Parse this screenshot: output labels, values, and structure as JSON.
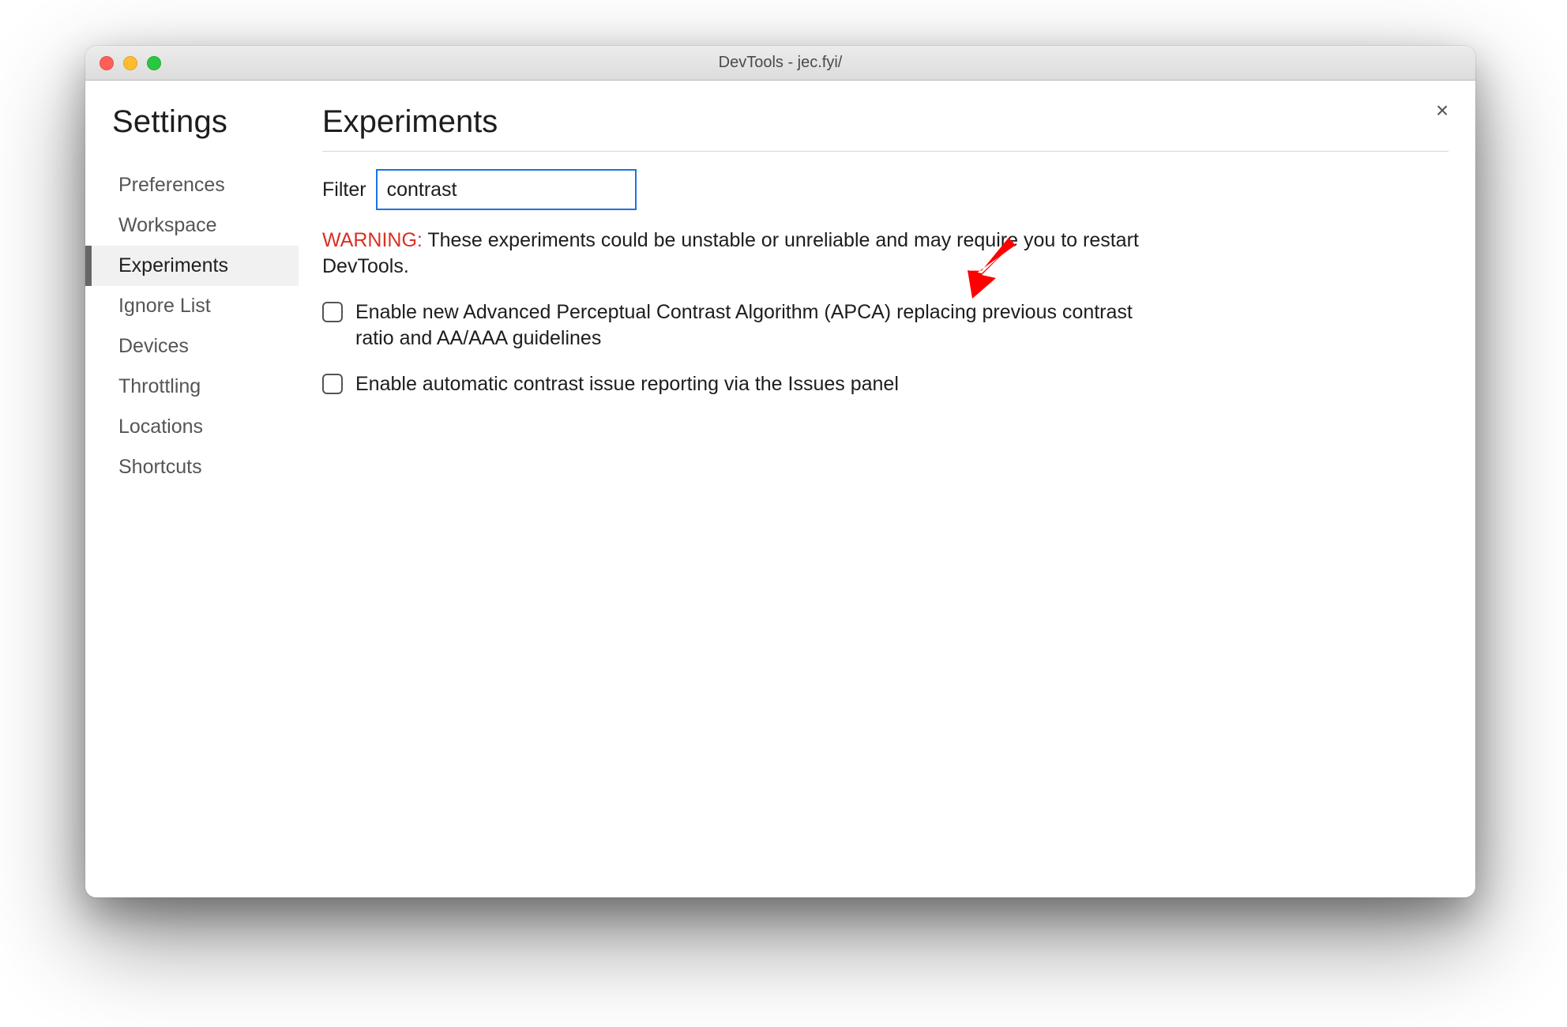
{
  "window": {
    "title": "DevTools - jec.fyi/"
  },
  "sidebar": {
    "title": "Settings",
    "items": [
      {
        "label": "Preferences",
        "active": false
      },
      {
        "label": "Workspace",
        "active": false
      },
      {
        "label": "Experiments",
        "active": true
      },
      {
        "label": "Ignore List",
        "active": false
      },
      {
        "label": "Devices",
        "active": false
      },
      {
        "label": "Throttling",
        "active": false
      },
      {
        "label": "Locations",
        "active": false
      },
      {
        "label": "Shortcuts",
        "active": false
      }
    ]
  },
  "content": {
    "title": "Experiments",
    "filter_label": "Filter",
    "filter_value": "contrast",
    "warning_prefix": "WARNING:",
    "warning_text": " These experiments could be unstable or unreliable and may require you to restart DevTools.",
    "experiments": [
      {
        "label": "Enable new Advanced Perceptual Contrast Algorithm (APCA) replacing previous contrast ratio and AA/AAA guidelines",
        "checked": false
      },
      {
        "label": "Enable automatic contrast issue reporting via the Issues panel",
        "checked": false
      }
    ]
  },
  "close_label": "×",
  "annotation": {
    "arrow_color": "#ff0000"
  }
}
